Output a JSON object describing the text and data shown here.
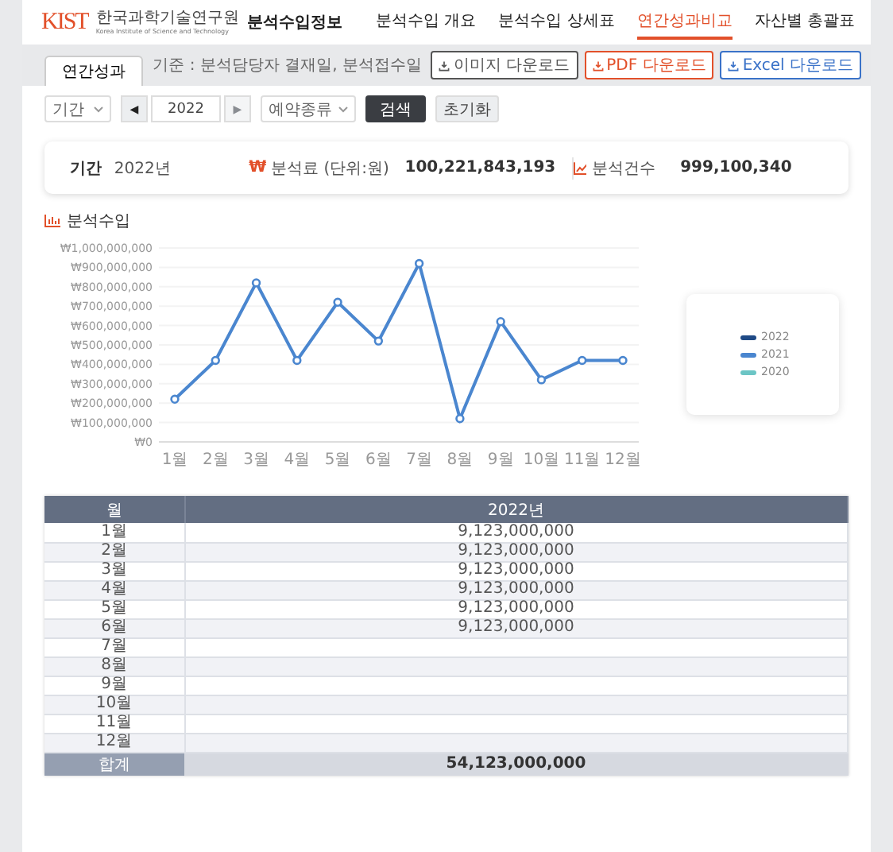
{
  "logo": {
    "mark": "KIST",
    "name": "한국과학기술연구원",
    "subtitle": "Korea Institute of Science and Technology",
    "service": "분석수입정보"
  },
  "nav": [
    {
      "label": "분석수입 개요",
      "selected": false
    },
    {
      "label": "분석수입 상세표",
      "selected": false
    },
    {
      "label": "연간성과비교",
      "selected": true
    },
    {
      "label": "자산별 총괄표",
      "selected": false
    }
  ],
  "tabs": [
    {
      "label": "연간성과",
      "selected": true
    }
  ],
  "note": "기준 : 분석담당자 결재일, 분석접수일",
  "downloads": [
    {
      "label": "이미지 다운로드",
      "kind": "image"
    },
    {
      "label": "PDF 다운로드",
      "kind": "pdf"
    },
    {
      "label": "Excel 다운로드",
      "kind": "excel"
    }
  ],
  "filters": {
    "period": "기간",
    "prev": {
      "label": "◀",
      "disabled": false
    },
    "year": "2022",
    "next": {
      "label": "▶",
      "disabled": true
    },
    "type": "예약종류",
    "search": "검색",
    "reset": "초기화"
  },
  "summary": {
    "period_label": "기간",
    "period_value": "2022년",
    "fee_symbol": "₩",
    "fee_label": "분석료 (단위:원)",
    "fee_value": "100,221,843,193",
    "count_label": "분석건수",
    "count_value": "999,100,340"
  },
  "chart_title": "분석수입",
  "chart_data": {
    "type": "line",
    "grid": true,
    "categories": [
      "1월",
      "2월",
      "3월",
      "4월",
      "5월",
      "6월",
      "7월",
      "8월",
      "9월",
      "10월",
      "11월",
      "12월"
    ],
    "series": [
      {
        "name": "2022",
        "color": "#1f4a86",
        "values": [
          null,
          null,
          null,
          null,
          null,
          null,
          null,
          null,
          null,
          null,
          null,
          null
        ]
      },
      {
        "name": "2021",
        "color": "#4a86cf",
        "marker": true,
        "values": [
          220000000,
          420000000,
          820000000,
          420000000,
          720000000,
          520000000,
          920000000,
          120000000,
          620000000,
          320000000,
          420000000,
          420000000
        ]
      },
      {
        "name": "2020",
        "color": "#6cc5c5",
        "values": [
          null,
          null,
          null,
          null,
          null,
          null,
          null,
          null,
          null,
          null,
          null,
          null
        ]
      }
    ],
    "ylim": [
      0,
      1000000000
    ],
    "yticks": [
      {
        "value": 0,
        "label": "₩0"
      },
      {
        "value": 100000000,
        "label": "₩100,000,000"
      },
      {
        "value": 200000000,
        "label": "₩200,000,000"
      },
      {
        "value": 300000000,
        "label": "₩300,000,000"
      },
      {
        "value": 400000000,
        "label": "₩400,000,000"
      },
      {
        "value": 500000000,
        "label": "₩500,000,000"
      },
      {
        "value": 600000000,
        "label": "₩600,000,000"
      },
      {
        "value": 700000000,
        "label": "₩700,000,000"
      },
      {
        "value": 800000000,
        "label": "₩800,000,000"
      },
      {
        "value": 900000000,
        "label": "₩900,000,000"
      },
      {
        "value": 1000000000,
        "label": "₩1,000,000,000"
      }
    ]
  },
  "table": {
    "columns": [
      "월",
      "2022년"
    ],
    "rows": [
      [
        "1월",
        "9,123,000,000"
      ],
      [
        "2월",
        "9,123,000,000"
      ],
      [
        "3월",
        "9,123,000,000"
      ],
      [
        "4월",
        "9,123,000,000"
      ],
      [
        "5월",
        "9,123,000,000"
      ],
      [
        "6월",
        "9,123,000,000"
      ],
      [
        "7월",
        ""
      ],
      [
        "8월",
        ""
      ],
      [
        "9월",
        ""
      ],
      [
        "10월",
        ""
      ],
      [
        "11월",
        ""
      ],
      [
        "12월",
        ""
      ]
    ],
    "total": [
      "합계",
      "54,123,000,000"
    ]
  }
}
